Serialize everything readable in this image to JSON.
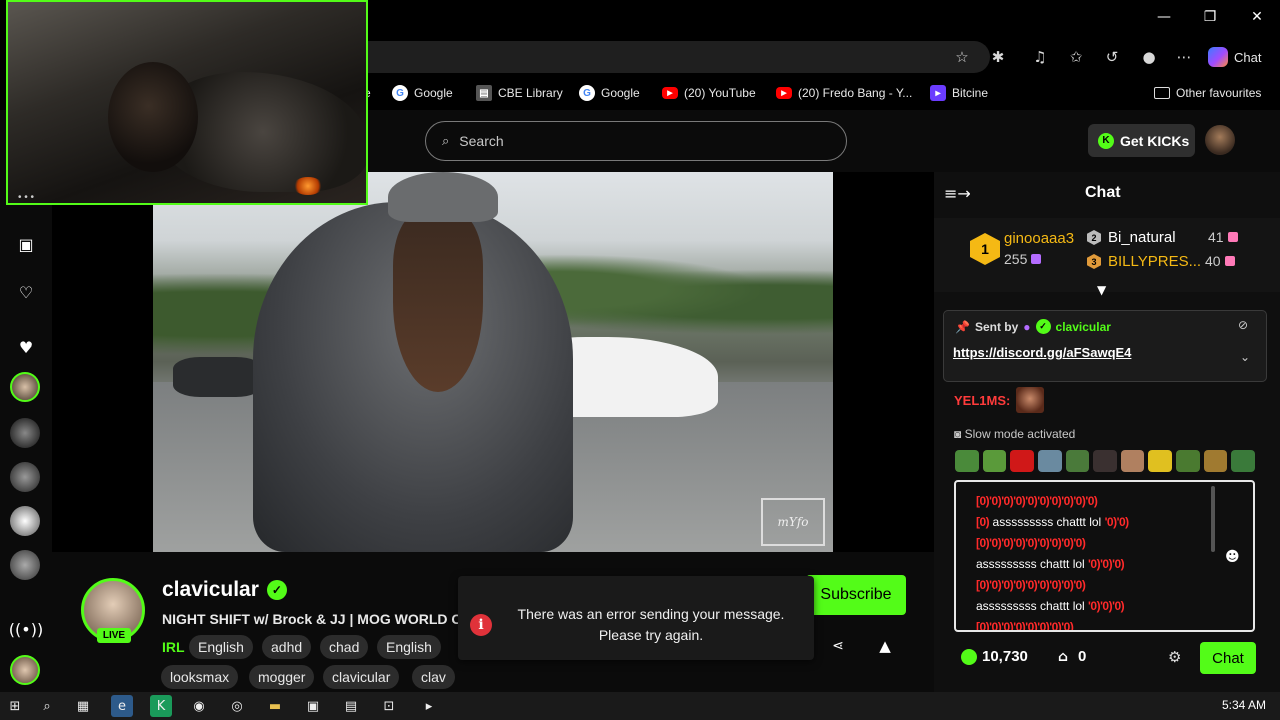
{
  "window": {
    "minimize": "—",
    "restore": "❐",
    "close": "✕"
  },
  "browser_toolbar": {
    "chat_label": "Chat"
  },
  "bookmarks": [
    {
      "label": "e",
      "icon": "partial-icon"
    },
    {
      "label": "Google",
      "icon": "google-icon"
    },
    {
      "label": "CBE Library",
      "icon": "cbe-icon"
    },
    {
      "label": "Google",
      "icon": "google-icon"
    },
    {
      "label": "(20) YouTube",
      "icon": "youtube-icon"
    },
    {
      "label": "(20) Fredo Bang - Y...",
      "icon": "youtube-icon"
    },
    {
      "label": "Bitcine",
      "icon": "bitcine-icon"
    }
  ],
  "other_favourites": "Other favourites",
  "header": {
    "search_placeholder": "Search",
    "get_kicks": "Get KICKs"
  },
  "stream": {
    "streamer": "clavicular",
    "live_badge": "LIVE",
    "title": "NIGHT SHIFT w/ Brock & JJ | MOG WORLD C",
    "category": "IRL",
    "tags": [
      "English",
      "adhd",
      "chad",
      "English",
      "looksmax",
      "mogger",
      "clavicular",
      "clav"
    ],
    "subscribe": "Subscribe",
    "watermark": "mYfo"
  },
  "error_toast": {
    "message": "There was an error sending your message. Please try again."
  },
  "chat": {
    "title": "Chat",
    "leaderboard": [
      {
        "rank": "1",
        "name": "ginooaaa3",
        "value": "255"
      },
      {
        "rank": "2",
        "name": "Bi_natural",
        "value": "41"
      },
      {
        "rank": "3",
        "name": "BILLYPRES...",
        "value": "40"
      }
    ],
    "pinned": {
      "sent_by_label": "Sent by",
      "sender": "clavicular",
      "link": "https://discord.gg/aFSawqE4"
    },
    "message_user": "YEL1MS:",
    "slow_mode": "Slow mode activated",
    "input_lines": [
      {
        "red": "[0)'0)'0)'0)'0)'0)'0)'0)'0)'0)",
        "text": ""
      },
      {
        "red": "[0)",
        "text": "asssssssss chattt lol",
        "red2": "'0)'0)"
      },
      {
        "red": "[0)'0)'0)'0)'0)'0)'0)'0)'0)",
        "text": ""
      },
      {
        "red": "",
        "text": "asssssssss chattt lol",
        "red2": "'0)'0)'0)"
      },
      {
        "red": "[0)'0)'0)'0)'0)'0)'0)'0)'0)",
        "text": ""
      },
      {
        "red": "",
        "text": "asssssssss chattt lol",
        "red2": "'0)'0)'0)"
      },
      {
        "red": "[0)'0)'0)'0)'0)'0)'0)'0)",
        "text": ""
      }
    ],
    "points": "10,730",
    "shop_count": "0",
    "send": "Chat"
  },
  "taskbar": {
    "clock": "5:34 AM"
  },
  "colors": {
    "kick_green": "#53fc18",
    "error_red": "#e0323a",
    "gold": "#f5b914"
  }
}
